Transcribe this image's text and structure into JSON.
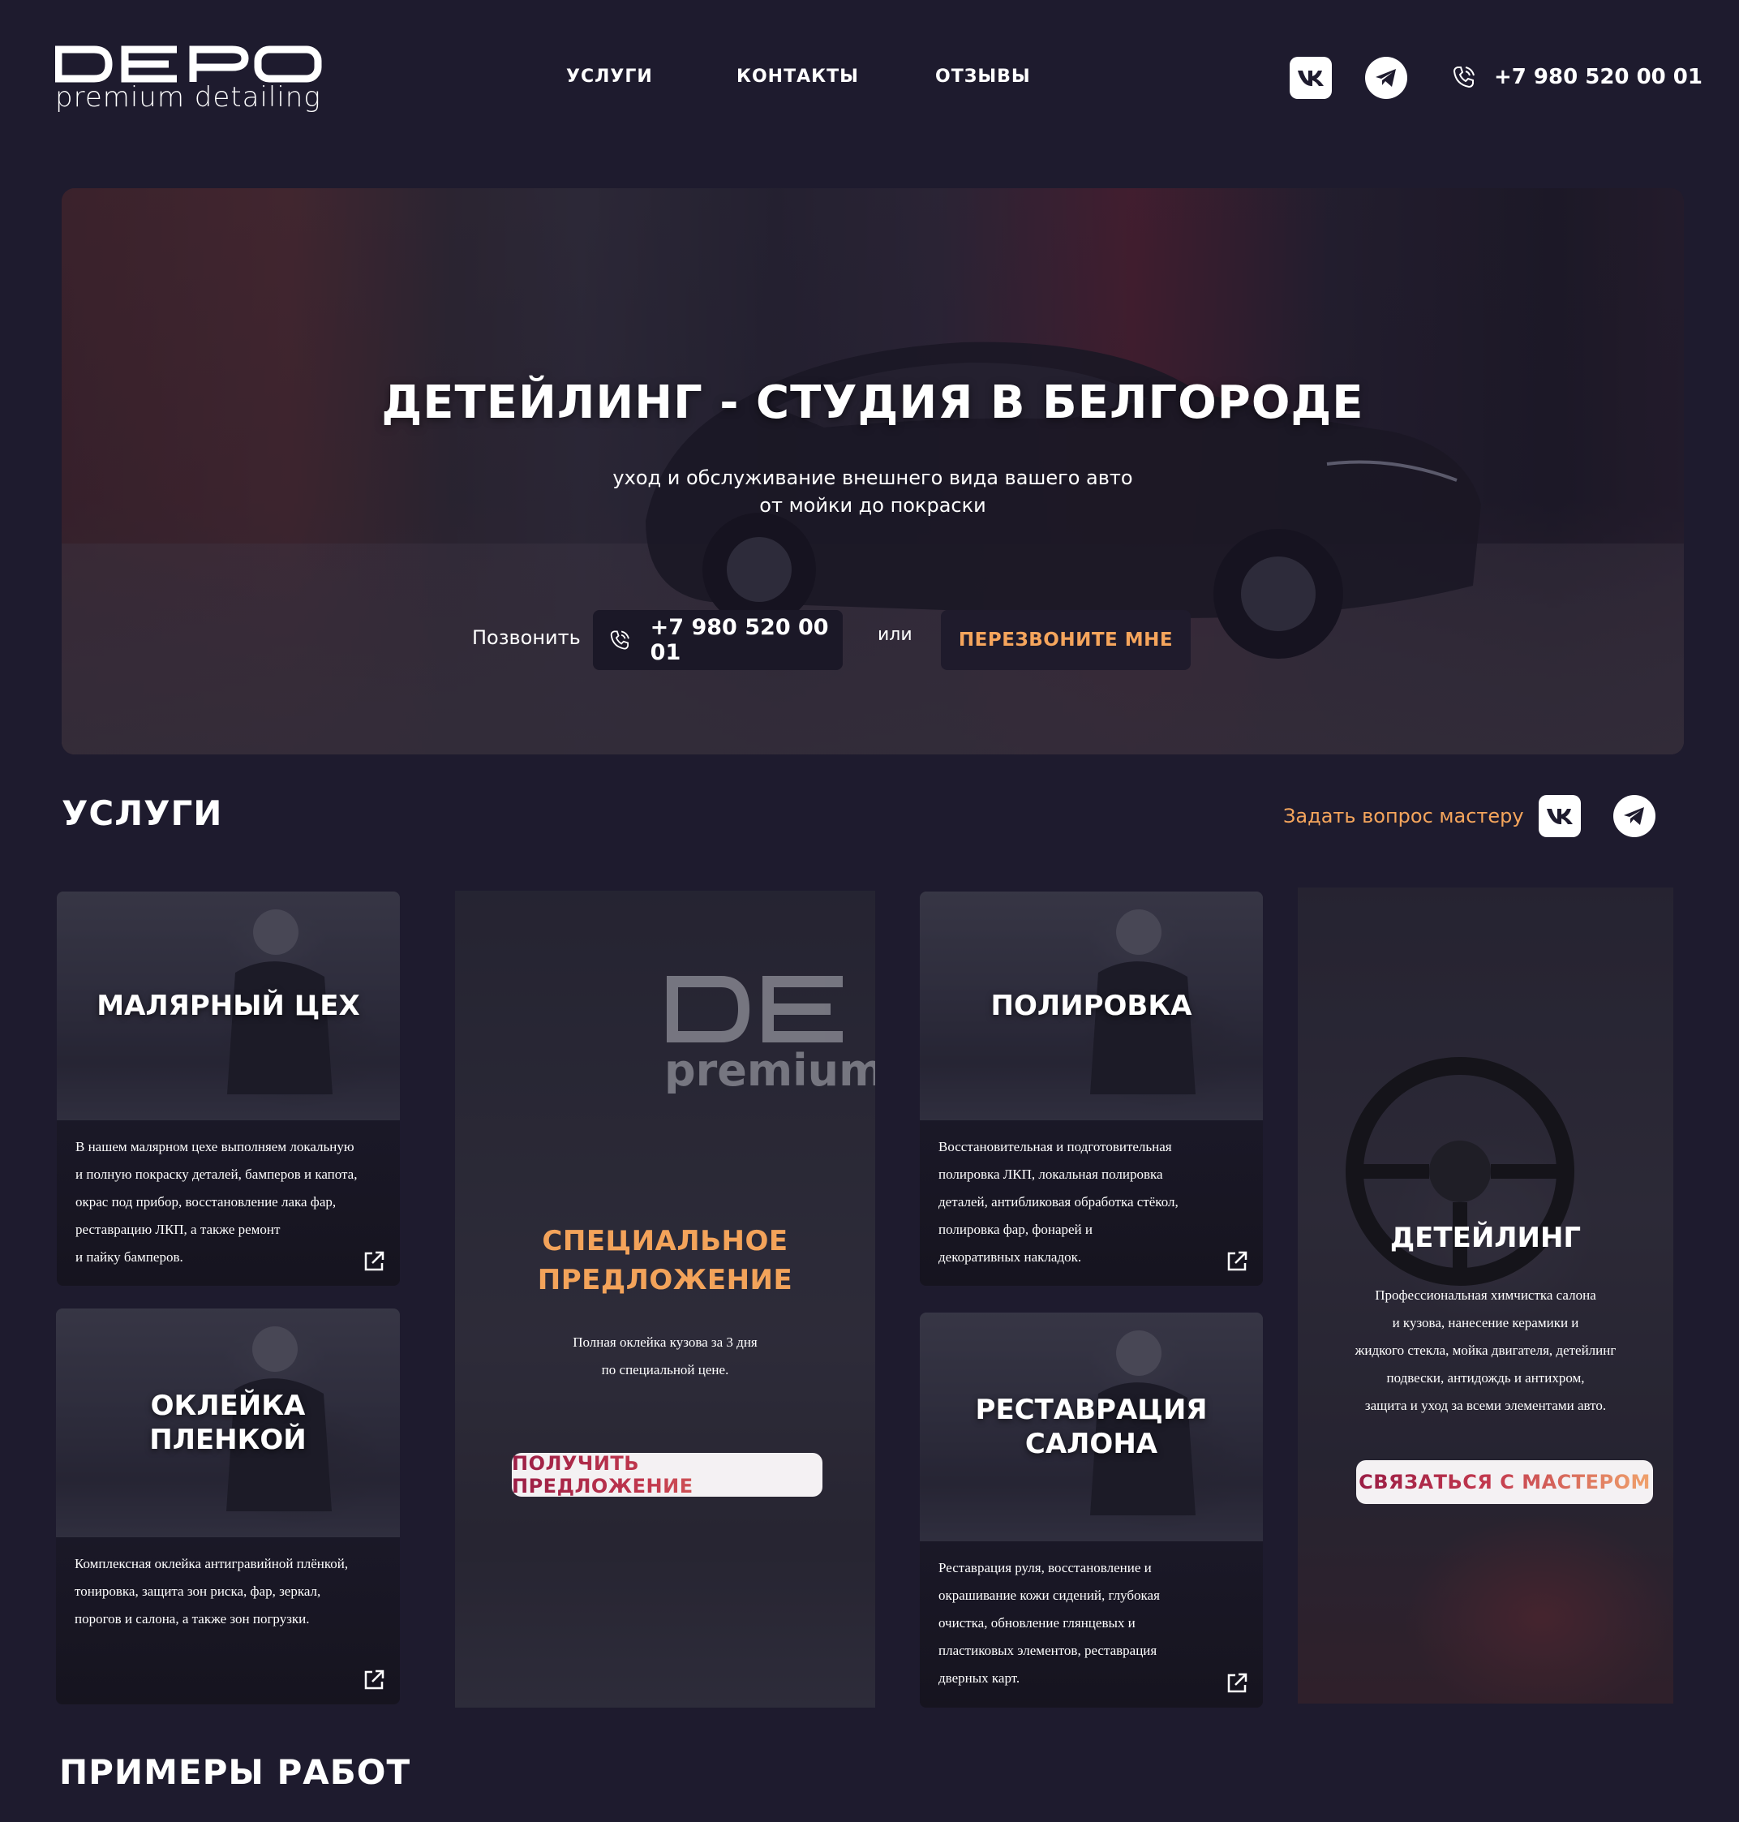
{
  "brand": {
    "logo_text": "DEPO",
    "logo_sub": "premium detailing"
  },
  "nav": [
    {
      "label": "УСЛУГИ"
    },
    {
      "label": "КОНТАКТЫ"
    },
    {
      "label": "ОТЗЫВЫ"
    }
  ],
  "header": {
    "phone": "+7 980 520 00 01",
    "social_icons": [
      "vk-icon",
      "telegram-icon"
    ]
  },
  "hero": {
    "title": "ДЕТЕЙЛИНГ - СТУДИЯ В БЕЛГОРОДЕ",
    "subtitle_line1": "уход и обслуживание внешнего вида вашего авто",
    "subtitle_line2": "от мойки до покраски",
    "call_label": "Позвонить",
    "phone": "+7 980 520 00 01",
    "or_label": "или",
    "callback_label": "ПЕРЕЗВОНИТЕ МНЕ"
  },
  "services": {
    "title": "УСЛУГИ",
    "ask_master": "Задать вопрос мастеру",
    "cards": [
      {
        "title": "МАЛЯРНЫЙ ЦЕХ",
        "lines": [
          "В нашем малярном цехе выполняем локальную",
          "и полную покраску деталей, бамперов и капота,",
          "окрас под прибор, восстановление лака фар,",
          "реставрацию ЛКП, а также ремонт",
          "и пайку бамперов."
        ]
      },
      {
        "title_line1": "ОКЛЕЙКА",
        "title_line2": "ПЛЕНКОЙ",
        "lines": [
          "Комплексная оклейка антигравийной плёнкой,",
          "тонировка, защита зон риска, фар, зеркал,",
          "порогов и салона, а также зон погрузки."
        ]
      },
      {
        "title": "ПОЛИРОВКА",
        "lines": [
          "Восстановительная и подготовительная",
          "полировка ЛКП, локальная полировка",
          "деталей, антибликовая обработка стёкол,",
          "полировка фар, фонарей и",
          "декоративных накладок."
        ]
      },
      {
        "title_line1": "РЕСТАВРАЦИЯ",
        "title_line2": "САЛОНА",
        "lines": [
          "Реставрация руля, восстановление и",
          "окрашивание кожи сидений, глубокая",
          "очистка, обновление глянцевых и",
          "пластиковых элементов, реставрация",
          "дверных карт."
        ]
      }
    ],
    "special": {
      "title_line1": "СПЕЦИАЛЬНОЕ",
      "title_line2": "ПРЕДЛОЖЕНИЕ",
      "text_line1": "Полная оклейка кузова за 3 дня",
      "text_line2": "по специальной цене.",
      "button": "ПОЛУЧИТЬ ПРЕДЛОЖЕНИЕ",
      "watermark_line1": "DE",
      "watermark_line2": "premium"
    },
    "detailing": {
      "title": "ДЕТЕЙЛИНГ",
      "lines": [
        "Профессиональная химчистка салона",
        "и кузова, нанесение керамики и",
        "жидкого стекла, мойка двигателя, детейлинг",
        "подвески, антидождь и антихром,",
        "защита и уход за всеми элементами авто."
      ],
      "button": "СВЯЗАТЬСЯ С МАСТЕРОМ"
    }
  },
  "examples": {
    "title": "ПРИМЕРЫ РАБОТ"
  },
  "colors": {
    "background": "#1e1b2e",
    "accent_orange": "#f5a55c",
    "accent_crimson": "#9a1d45"
  }
}
